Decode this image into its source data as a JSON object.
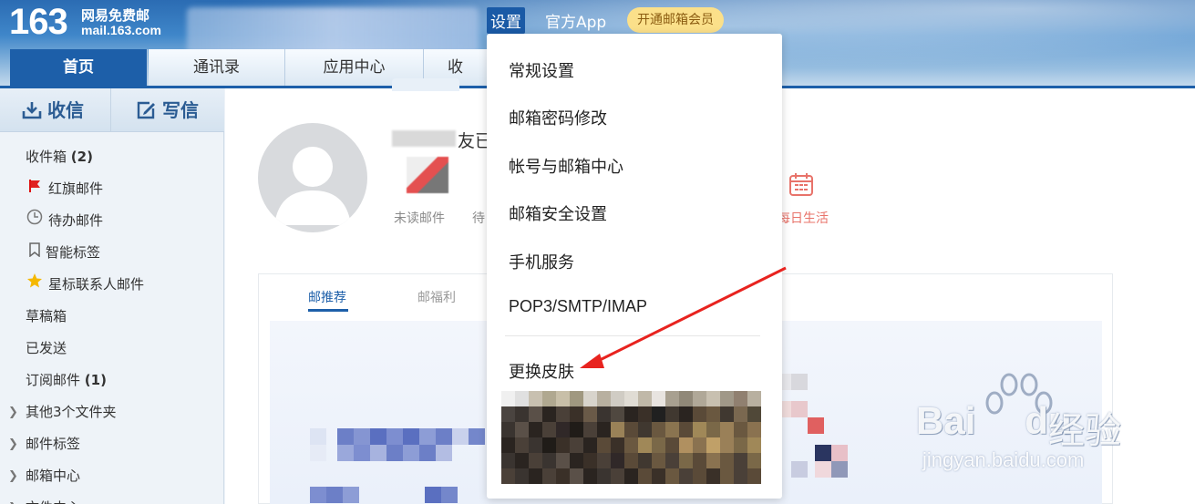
{
  "header": {
    "logo_number": "163",
    "logo_cn": "网易免费邮",
    "logo_url": "mail.163.com",
    "settings_link": "设置",
    "app_link": "官方App",
    "vip_button": "开通邮箱会员"
  },
  "tabs": [
    {
      "label": "首页",
      "active": true
    },
    {
      "label": "通讯录",
      "active": false
    },
    {
      "label": "应用中心",
      "active": false
    },
    {
      "label": "收",
      "active": false
    }
  ],
  "sidebar": {
    "receive_label": "收信",
    "write_label": "写信",
    "folders": [
      {
        "label": "收件箱",
        "count": "(2)",
        "icon": "none"
      },
      {
        "label": "红旗邮件",
        "icon": "flag-icon"
      },
      {
        "label": "待办邮件",
        "icon": "clock-icon"
      },
      {
        "label": "智能标签",
        "icon": "bookmark-icon"
      },
      {
        "label": "星标联系人邮件",
        "icon": "star-icon"
      },
      {
        "label": "草稿箱",
        "icon": "none"
      },
      {
        "label": "已发送",
        "icon": "none"
      },
      {
        "label": "订阅邮件",
        "count": "(1)",
        "icon": "none"
      },
      {
        "label": "其他3个文件夹",
        "icon": "caret-icon"
      },
      {
        "label": "邮件标签",
        "icon": "caret-icon"
      },
      {
        "label": "邮箱中心",
        "icon": "caret-icon"
      },
      {
        "label": "文件中心",
        "icon": "caret-icon"
      }
    ]
  },
  "main": {
    "greeting_fragment": "友已",
    "stat_unread": "未读邮件",
    "stat_todo": "待",
    "daily_life": "每日生活",
    "subtabs": [
      {
        "label": "邮推荐",
        "active": true
      },
      {
        "label": "邮福利",
        "active": false
      }
    ]
  },
  "settings_menu": {
    "items": [
      "常规设置",
      "邮箱密码修改",
      "帐号与邮箱中心",
      "邮箱安全设置",
      "手机服务",
      "POP3/SMTP/IMAP",
      "更换皮肤"
    ]
  },
  "watermark": {
    "brand": "Bai",
    "brand_tail": "du",
    "cn": "经验",
    "url": "jingyan.baidu.com"
  },
  "colors": {
    "accent": "#1d5fa9",
    "vip": "#fbe08a",
    "arrow": "#e8231f",
    "life": "#e8736a"
  }
}
